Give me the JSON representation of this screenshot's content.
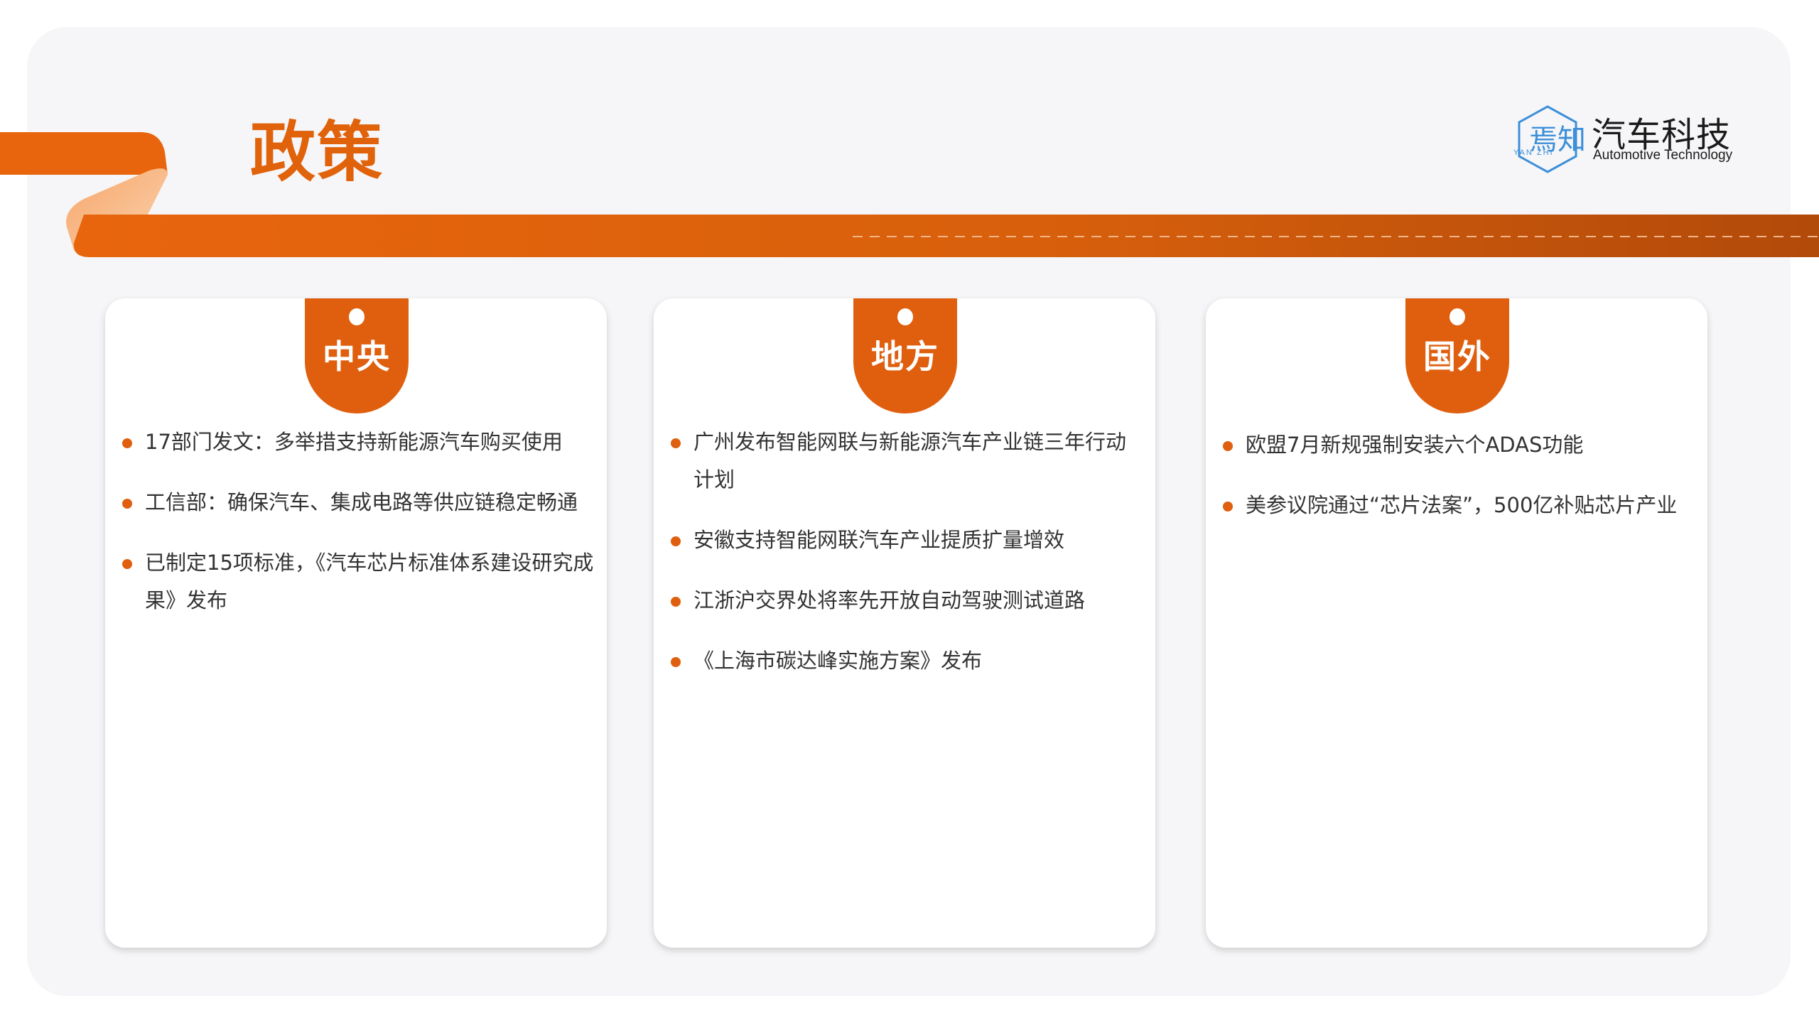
{
  "title": "政策",
  "logo": {
    "cn": "汽车科技",
    "en": "Automotive Technology",
    "icon_text": "焉知",
    "icon_subtext": "YAN ZHI",
    "icon": "yanzhi-logo-icon"
  },
  "colors": {
    "accent": "#df5f0e",
    "ribbon_dark": "#b84d0a",
    "background": "#f6f6f8",
    "card": "#ffffff",
    "logo_blue": "#3c8fd9"
  },
  "cards": [
    {
      "label": "中央",
      "items": [
        "17部门发文：多举措支持新能源汽车购买使用",
        "工信部：确保汽车、集成电路等供应链稳定畅通",
        "已制定15项标准，《汽车芯片标准体系建设研究成果》发布"
      ]
    },
    {
      "label": "地方",
      "items": [
        "广州发布智能网联与新能源汽车产业链三年行动计划",
        "安徽支持智能网联汽车产业提质扩量增效",
        "江浙沪交界处将率先开放自动驾驶测试道路",
        "《上海市碳达峰实施方案》发布"
      ]
    },
    {
      "label": "国外",
      "items": [
        "欧盟7月新规强制安装六个ADAS功能",
        "美参议院通过“芯片法案”，500亿补贴芯片产业"
      ]
    }
  ]
}
